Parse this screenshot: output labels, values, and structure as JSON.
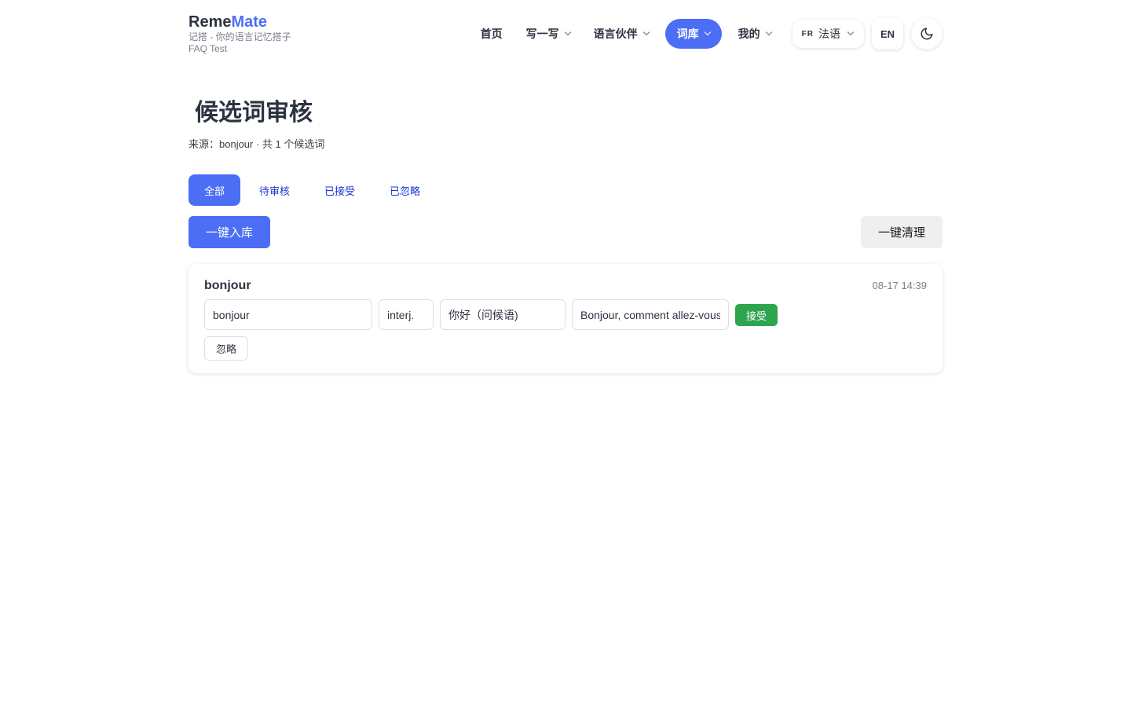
{
  "brand": {
    "name_part1": "Reme",
    "name_part2": "Mate",
    "tagline": "记搭 - 你的语言记忆搭子",
    "user": "FAQ Test",
    "accent_color": "#4c6ef5"
  },
  "nav": {
    "items": [
      {
        "label": "首页",
        "has_dropdown": false,
        "active": false
      },
      {
        "label": "写一写",
        "has_dropdown": true,
        "active": false
      },
      {
        "label": "语言伙伴",
        "has_dropdown": true,
        "active": false
      },
      {
        "label": "词库",
        "has_dropdown": true,
        "active": true
      },
      {
        "label": "我的",
        "has_dropdown": true,
        "active": false
      }
    ],
    "language": {
      "code": "FR",
      "label": "法语"
    },
    "ui_language": "EN",
    "theme_icon": "moon-icon"
  },
  "page": {
    "title": "候选词审核",
    "meta": "来源：bonjour · 共 1 个候选词"
  },
  "tabs": [
    {
      "label": "全部",
      "active": true
    },
    {
      "label": "待审核",
      "active": false
    },
    {
      "label": "已接受",
      "active": false
    },
    {
      "label": "已忽略",
      "active": false
    }
  ],
  "actions": {
    "import_all": "一键入库",
    "clean_all": "一键清理"
  },
  "candidates": [
    {
      "word": "bonjour",
      "time": "08-17 14:39",
      "fields": {
        "term": "bonjour",
        "pos": "interj.",
        "meaning": "你好（问候语)",
        "example": "Bonjour, comment allez-vous ?"
      },
      "accept_label": "接受",
      "ignore_label": "忽略"
    }
  ],
  "colors": {
    "primary": "#4c6ef5",
    "success": "#2ea44f",
    "tab_link": "#1a36d8"
  }
}
